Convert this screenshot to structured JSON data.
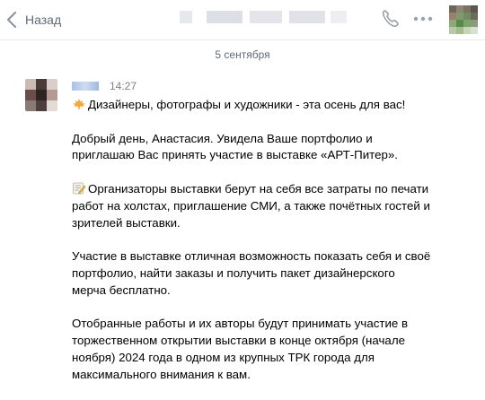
{
  "header": {
    "back_label": "Назад",
    "icons": [
      "chevron-left-icon",
      "phone-icon",
      "more-icon"
    ],
    "accent": "#5f6a78"
  },
  "chat": {
    "date_separator": "5 сентября",
    "message": {
      "time": "14:27",
      "paragraphs": [
        {
          "icon": "maple-leaf-icon",
          "text": "Дизайнеры, фотографы и художники - эта осень для вас!"
        },
        {
          "icon": "",
          "text": "Добрый день, Анастасия. Увидела Ваше портфолио и приглашаю Вас принять участие в выставке «АРТ-Питер»."
        },
        {
          "icon": "memo-icon",
          "text": "Организаторы выставки берут на себя все затраты по печати работ на холстах, приглашение СМИ, а также почётных гостей и зрителей выставки."
        },
        {
          "icon": "",
          "text": "Участие в выставке отличная возможность показать себя и своё портфолио, найти заказы и получить пакет дизайнерского мерча бесплатно."
        },
        {
          "icon": "",
          "text": "Отобранные работы и их авторы будут принимать участие в торжественном открытии выставки в конце октября (начале ноября) 2024 года в одном из крупных ТРК города для максимального внимания к вам."
        }
      ]
    }
  }
}
